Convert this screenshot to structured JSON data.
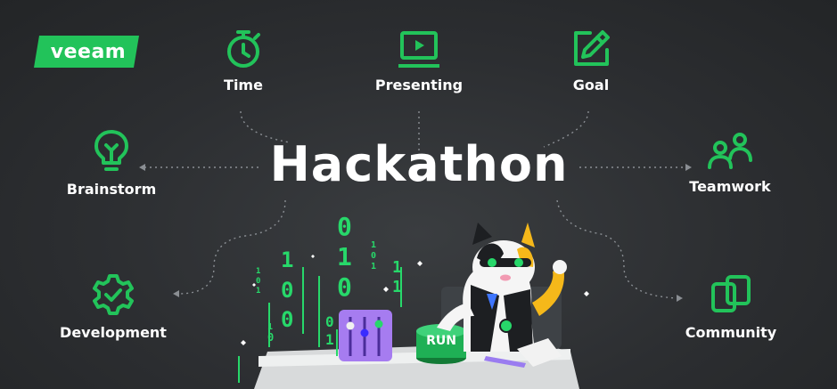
{
  "brand": {
    "logo_text": "veeam",
    "accent_color": "#22c35a"
  },
  "title": "Hackathon",
  "items": {
    "time": {
      "label": "Time",
      "icon": "stopwatch-icon"
    },
    "presenting": {
      "label": "Presenting",
      "icon": "presentation-screen-icon"
    },
    "goal": {
      "label": "Goal",
      "icon": "pencil-note-icon"
    },
    "brainstorm": {
      "label": "Brainstorm",
      "icon": "lightbulb-icon"
    },
    "teamwork": {
      "label": "Teamwork",
      "icon": "people-icon"
    },
    "development": {
      "label": "Development",
      "icon": "gear-check-icon"
    },
    "community": {
      "label": "Community",
      "icon": "linked-squares-icon"
    }
  },
  "illustration": {
    "run_button_label": "RUN"
  }
}
